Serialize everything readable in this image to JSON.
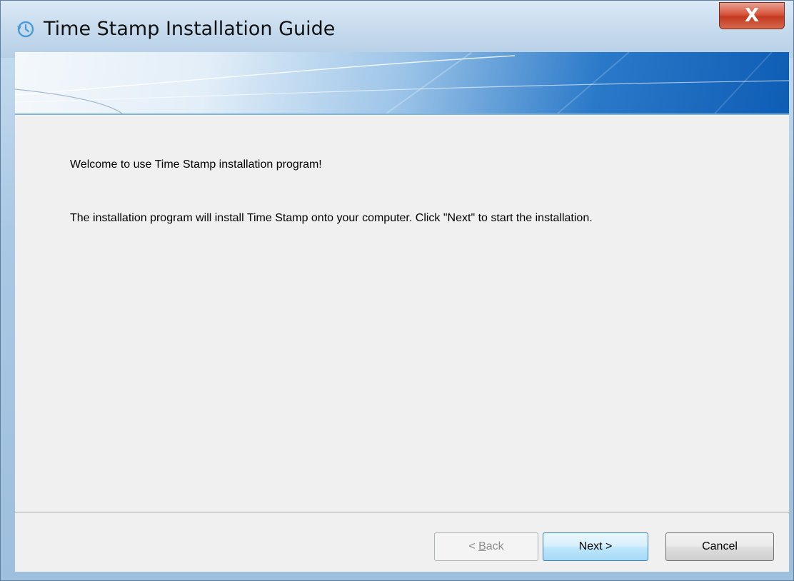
{
  "window": {
    "title": "Time Stamp Installation Guide",
    "title_icon": "clock-history-icon",
    "close_label": "X"
  },
  "content": {
    "welcome": "Welcome to use Time Stamp installation program!",
    "description": "The installation program will install Time Stamp onto your computer. Click \"Next\" to start the installation."
  },
  "buttons": {
    "back_prefix": "< ",
    "back_accel": "B",
    "back_rest": "ack",
    "back_enabled": false,
    "next_label": "Next >",
    "cancel_label": "Cancel"
  },
  "colors": {
    "accent": "#0e5db5",
    "client_bg": "#f0f0f0",
    "close_red": "#c23a20"
  }
}
